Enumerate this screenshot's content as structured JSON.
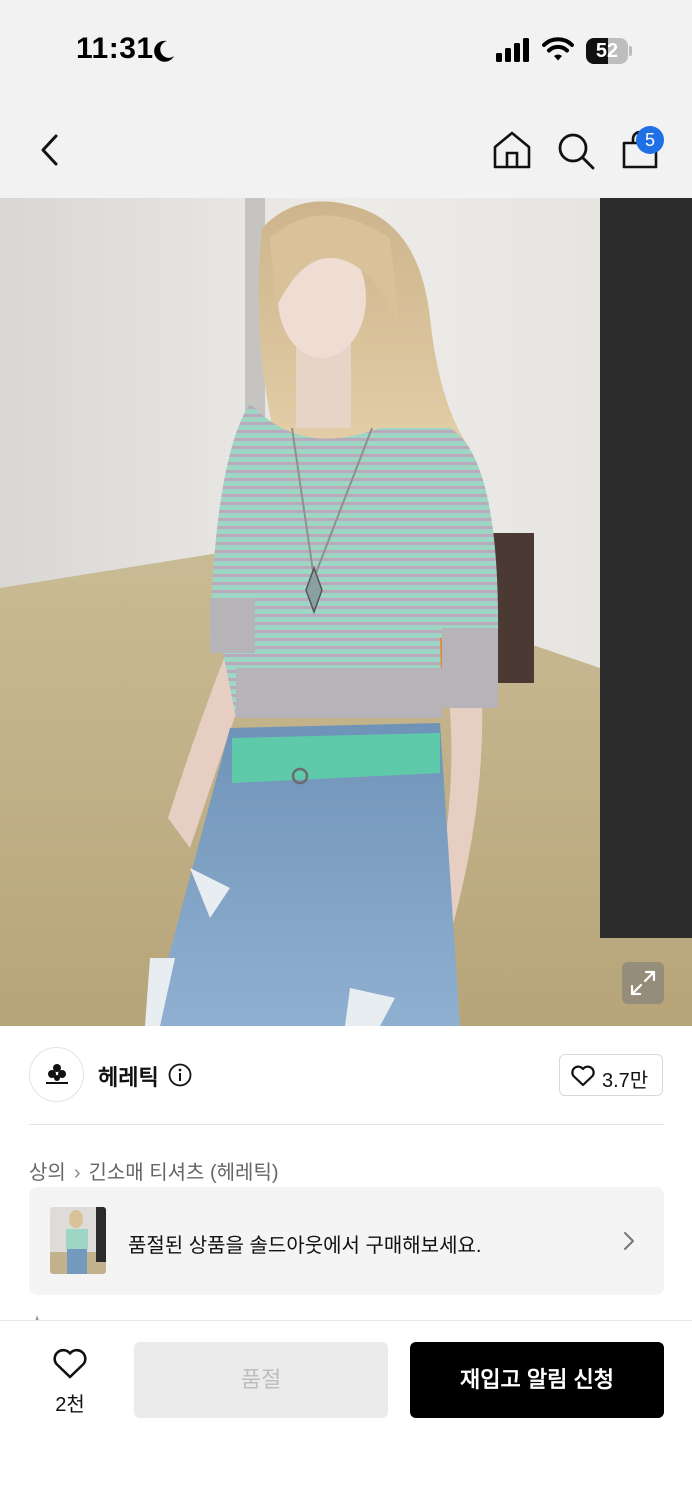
{
  "status_bar": {
    "time": "11:31",
    "battery": "52",
    "battery_level": 0.52
  },
  "header": {
    "cart_count": "5"
  },
  "brand": {
    "name": "헤레틱",
    "likes": "3.7만"
  },
  "breadcrumb": {
    "level1": "상의",
    "level2": "긴소매 티셔츠 (헤레틱)"
  },
  "soldout_banner": {
    "text": "품절된 상품을 솔드아웃에서 구매해보세요."
  },
  "bottom_bar": {
    "wish_count": "2천",
    "soldout_label": "품절",
    "restock_label": "재입고 알림 신청"
  },
  "colors": {
    "accent_blue": "#1f6fe5",
    "restock_button": "#000000",
    "soldout_button": "#ebebeb"
  }
}
